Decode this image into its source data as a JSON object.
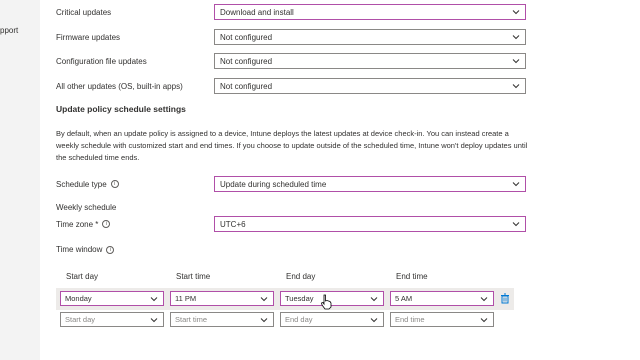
{
  "sidebar": {
    "snippet": "pport"
  },
  "updates": [
    {
      "label": "Critical updates",
      "value": "Download and install",
      "focused": true
    },
    {
      "label": "Firmware updates",
      "value": "Not configured",
      "focused": false
    },
    {
      "label": "Configuration file updates",
      "value": "Not configured",
      "focused": false
    },
    {
      "label": "All other updates (OS, built-in apps)",
      "value": "Not configured",
      "focused": false
    }
  ],
  "schedule_settings": {
    "title": "Update policy schedule settings",
    "description": "By default, when an update policy is assigned to a device, Intune deploys the latest updates at device check-in. You can instead create a weekly schedule with customized start and end times. If you choose to update outside of the scheduled time, Intune won't deploy updates until the scheduled time ends.",
    "schedule_type_label": "Schedule type",
    "schedule_type_value": "Update during scheduled time",
    "weekly_schedule_label": "Weekly schedule",
    "time_zone_label": "Time zone *",
    "time_zone_value": "UTC+6",
    "time_window_label": "Time window"
  },
  "time_window": {
    "headers": [
      "Start day",
      "Start time",
      "End day",
      "End time"
    ],
    "rows": [
      {
        "start_day": "Monday",
        "start_time": "11 PM",
        "end_day": "Tuesday",
        "end_time": "5 AM"
      }
    ],
    "empty_row": {
      "start_day": "Start day",
      "start_time": "Start time",
      "end_day": "End day",
      "end_time": "End time"
    }
  },
  "colors": {
    "focus_border": "#b04fa8",
    "trash_icon": "#0078d4"
  }
}
